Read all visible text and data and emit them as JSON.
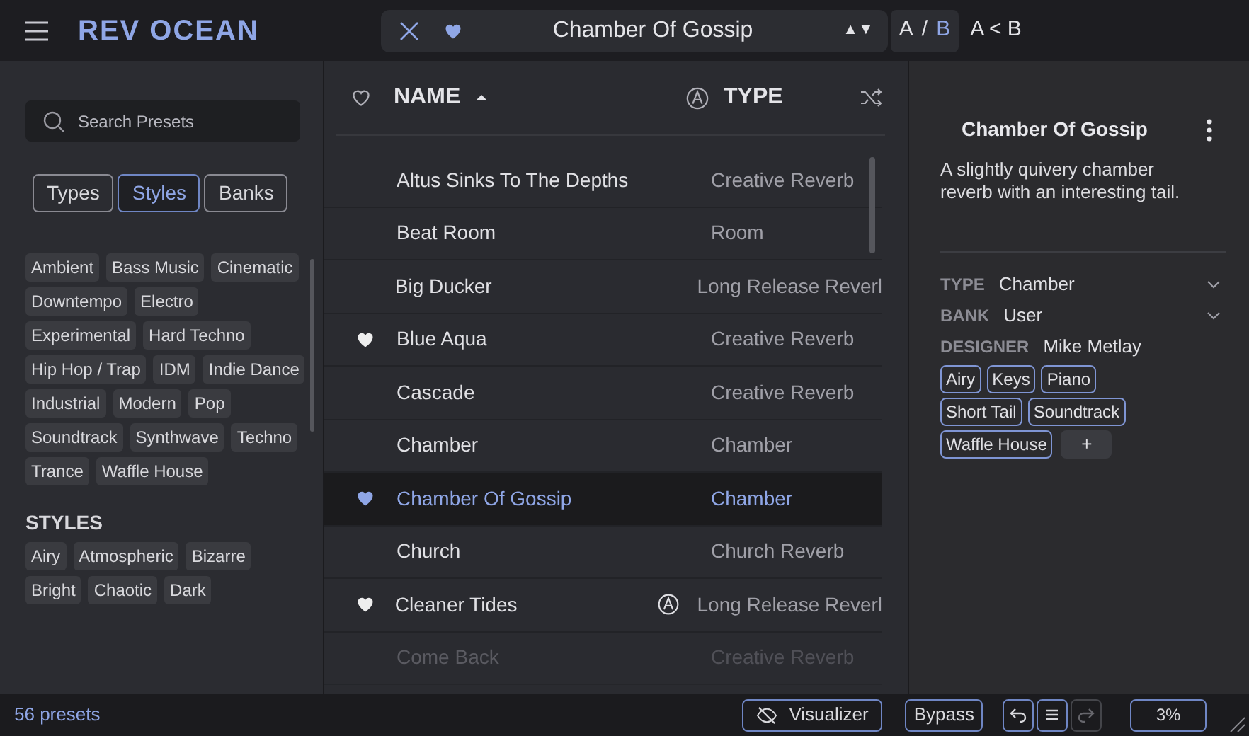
{
  "header": {
    "logo": "REV OCEAN",
    "preset_name": "Chamber Of Gossip",
    "preset_favorite": true,
    "step_arrows": "▲▼",
    "ab": [
      {
        "label": "A",
        "selected": false
      },
      {
        "label": "/",
        "selected": false
      },
      {
        "label": "B",
        "selected": true
      }
    ],
    "copy_ab": "A < B"
  },
  "browser": {
    "search": {
      "placeholder": "Search Presets"
    },
    "tabs": [
      {
        "label": "Types",
        "selected": false
      },
      {
        "label": "Styles",
        "selected": true
      },
      {
        "label": "Banks",
        "selected": false
      }
    ],
    "genre_tags": [
      "Ambient",
      "Bass Music",
      "Cinematic",
      "Downtempo",
      "Electro",
      "Experimental",
      "Hard Techno",
      "Hip Hop / Trap",
      "IDM",
      "Indie Dance",
      "Industrial",
      "Modern",
      "Pop",
      "Soundtrack",
      "Synthwave",
      "Techno",
      "Trance",
      "Waffle House"
    ],
    "styles_heading": "STYLES",
    "style_tags": [
      "Airy",
      "Atmospheric",
      "Bizarre",
      "Bright",
      "Chaotic",
      "Dark"
    ]
  },
  "list": {
    "columns": [
      {
        "label": "NAME",
        "sorted": true
      },
      {
        "label": "TYPE"
      }
    ],
    "rows": [
      {
        "name": "Altus Sinks To The Depths",
        "type": "Creative Reverb",
        "favorite": false,
        "factory": false,
        "selected": false,
        "faded": false
      },
      {
        "name": "Beat Room",
        "type": "Room",
        "favorite": false,
        "factory": false,
        "selected": false,
        "faded": false
      },
      {
        "name": "Big Ducker",
        "type": "Long Release Reverl",
        "favorite": false,
        "factory": false,
        "selected": false,
        "faded": false
      },
      {
        "name": "Blue Aqua",
        "type": "Creative Reverb",
        "favorite": true,
        "factory": false,
        "selected": false,
        "faded": false
      },
      {
        "name": "Cascade",
        "type": "Creative Reverb",
        "favorite": false,
        "factory": false,
        "selected": false,
        "faded": false
      },
      {
        "name": "Chamber",
        "type": "Chamber",
        "favorite": false,
        "factory": false,
        "selected": false,
        "faded": false
      },
      {
        "name": "Chamber Of Gossip",
        "type": "Chamber",
        "favorite": true,
        "factory": false,
        "selected": true,
        "faded": false
      },
      {
        "name": "Church",
        "type": "Church Reverb",
        "favorite": false,
        "factory": false,
        "selected": false,
        "faded": false
      },
      {
        "name": "Cleaner Tides",
        "type": "Long Release Reverl",
        "favorite": true,
        "factory": true,
        "selected": false,
        "faded": false
      },
      {
        "name": "Come Back",
        "type": "Creative Reverb",
        "favorite": false,
        "factory": false,
        "selected": false,
        "faded": true
      }
    ]
  },
  "details": {
    "title": "Chamber Of Gossip",
    "description": "A slightly quivery chamber reverb with an interesting tail.",
    "fields": [
      {
        "label": "TYPE",
        "value": "Chamber",
        "kind": "dropdown"
      },
      {
        "label": "BANK",
        "value": "User",
        "kind": "dropdown"
      },
      {
        "label": "DESIGNER",
        "value": "Mike Metlay",
        "kind": "text"
      }
    ],
    "tags": [
      "Airy",
      "Keys",
      "Piano",
      "Short Tail",
      "Soundtrack",
      "Waffle House"
    ],
    "add_tag": "+"
  },
  "status_bar": {
    "preset_count": "56 presets",
    "visualizer": "Visualizer",
    "bypass": "Bypass",
    "redo_disabled": true,
    "cpu": "3%"
  }
}
